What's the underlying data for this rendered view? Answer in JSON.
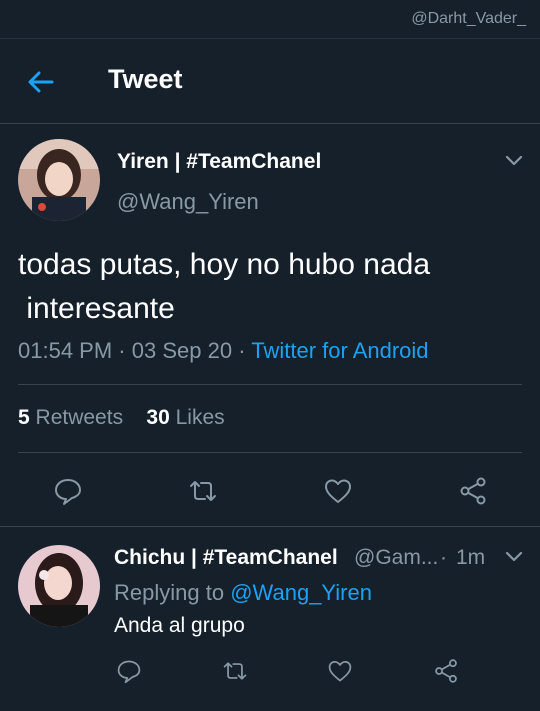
{
  "status_bar": {
    "watermark": "@Darht_Vader_"
  },
  "header": {
    "title": "Tweet"
  },
  "tweet": {
    "author_name": "Yiren | #TeamChanel",
    "author_handle": "@Wang_Yiren",
    "text": "todas putas, hoy no hubo nada\n interesante",
    "time": "01:54 PM",
    "date": "03 Sep 20",
    "separator": "·",
    "source": "Twitter for Android",
    "retweets_count": "5",
    "retweets_label": "Retweets",
    "likes_count": "30",
    "likes_label": "Likes"
  },
  "reply": {
    "author_name": "Chichu | #TeamChanel",
    "author_handle": "@Gam...",
    "time": "1m",
    "replying_to_label": "Replying to",
    "replying_to_handle": "@Wang_Yiren",
    "text": "Anda al grupo"
  },
  "icons": {
    "back": "arrow-left-icon",
    "chevron": "chevron-down-icon",
    "reply": "comment-icon",
    "retweet": "retweet-icon",
    "like": "heart-icon",
    "share": "share-icon"
  },
  "colors": {
    "background": "#15202b",
    "accent": "#1da1f2",
    "secondary_text": "#8899a6",
    "divider": "#38444d"
  }
}
